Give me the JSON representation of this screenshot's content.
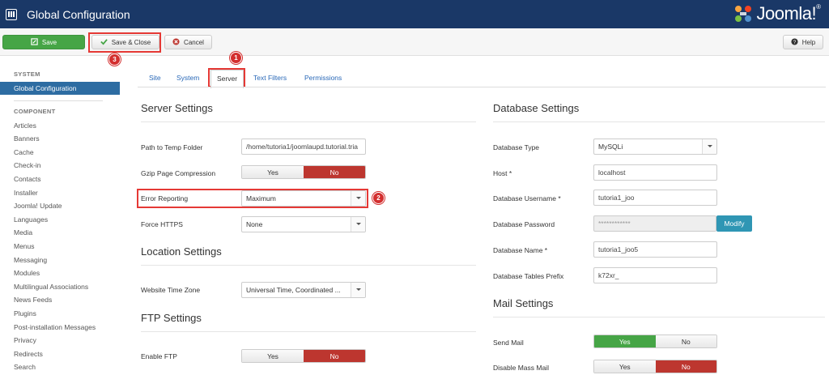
{
  "header": {
    "title": "Global Configuration",
    "logo_text": "Joomla!",
    "logo_reg": "®"
  },
  "toolbar": {
    "save": "Save",
    "save_close": "Save & Close",
    "cancel": "Cancel",
    "help": "Help"
  },
  "markers": [
    "1",
    "2",
    "3"
  ],
  "sidebar": {
    "system_heading": "SYSTEM",
    "active": "Global Configuration",
    "component_heading": "COMPONENT",
    "items": [
      "Articles",
      "Banners",
      "Cache",
      "Check-in",
      "Contacts",
      "Installer",
      "Joomla! Update",
      "Languages",
      "Media",
      "Menus",
      "Messaging",
      "Modules",
      "Multilingual Associations",
      "News Feeds",
      "Plugins",
      "Post-installation Messages",
      "Privacy",
      "Redirects",
      "Search"
    ]
  },
  "tabs": [
    "Site",
    "System",
    "Server",
    "Text Filters",
    "Permissions"
  ],
  "server": {
    "title": "Server Settings",
    "temp_label": "Path to Temp Folder",
    "temp_value": "/home/tutoria1/joomlaupd.tutorial.tria",
    "gzip_label": "Gzip Page Compression",
    "error_label": "Error Reporting",
    "error_value": "Maximum",
    "https_label": "Force HTTPS",
    "https_value": "None"
  },
  "location": {
    "title": "Location Settings",
    "tz_label": "Website Time Zone",
    "tz_value": "Universal Time, Coordinated ..."
  },
  "ftp": {
    "title": "FTP Settings",
    "enable_label": "Enable FTP"
  },
  "toggle": {
    "yes": "Yes",
    "no": "No"
  },
  "database": {
    "title": "Database Settings",
    "type_label": "Database Type",
    "type_value": "MySQLi",
    "host_label": "Host *",
    "host_value": "localhost",
    "user_label": "Database Username *",
    "user_value": "tutoria1_joo",
    "pass_label": "Database Password",
    "pass_value": "************",
    "modify": "Modify",
    "name_label": "Database Name *",
    "name_value": "tutoria1_joo5",
    "prefix_label": "Database Tables Prefix",
    "prefix_value": "k72xr_"
  },
  "mail": {
    "title": "Mail Settings",
    "send_label": "Send Mail",
    "mass_label": "Disable Mass Mail"
  },
  "colors": {
    "header_bg": "#1a3867",
    "save_green": "#46a546",
    "no_red": "#bd362f",
    "active_blue": "#2d6ca2",
    "modify_blue": "#2f96b4",
    "annotation_red": "#e53935"
  }
}
